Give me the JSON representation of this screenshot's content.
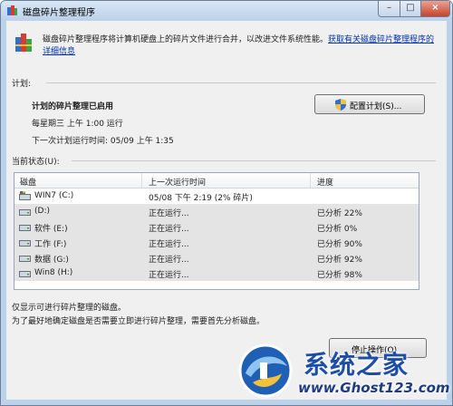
{
  "window": {
    "title": "磁盘碎片整理程序"
  },
  "controls": {
    "minimize": "–",
    "maximize": "□",
    "close": "×"
  },
  "intro": {
    "text": "磁盘碎片整理程序将计算机硬盘上的碎片文件进行合并，以改进文件系统性能。",
    "link": "获取有关磁盘碎片整理程序的详细信息"
  },
  "schedule": {
    "label": "计划:",
    "heading": "计划的碎片整理已启用",
    "run_time": "每星期三 上午 1:00 运行",
    "next_run": "下一次计划运行时间: 05/09 上午 1:35",
    "configure_button": "配置计划(S)..."
  },
  "status": {
    "label": "当前状态(U):",
    "columns": [
      "磁盘",
      "上一次运行时间",
      "进度"
    ],
    "rows": [
      {
        "disk": "WIN7 (C:)",
        "last_run": "05/08 下午 2:19 (2% 碎片)",
        "progress": ""
      },
      {
        "disk": "(D:)",
        "last_run": "正在运行...",
        "progress": "已分析 22%"
      },
      {
        "disk": "软件 (E:)",
        "last_run": "正在运行...",
        "progress": "已分析 0%"
      },
      {
        "disk": "工作 (F:)",
        "last_run": "正在运行...",
        "progress": "已分析 90%"
      },
      {
        "disk": "数据 (G:)",
        "last_run": "正在运行...",
        "progress": "已分析 92%"
      },
      {
        "disk": "Win8 (H:)",
        "last_run": "正在运行...",
        "progress": "已分析 98%"
      }
    ]
  },
  "footer": {
    "note1": "仅显示可进行碎片整理的磁盘。",
    "note2": "为了最好地确定磁盘是否需要立即进行碎片整理，需要首先分析磁盘。",
    "stop_button": "停止操作(O)"
  },
  "watermark": {
    "title": "系统之家",
    "url": "www.Ghost123.com"
  },
  "colors": {
    "link": "#0033aa",
    "selection_row": "#e4e4e4",
    "title_bar": "#bcd2ea",
    "close_button": "#c5432c"
  },
  "icons": {
    "app": "defrag-app-icon",
    "shield": "uac-shield-icon",
    "drive": "hard-drive-icon"
  }
}
